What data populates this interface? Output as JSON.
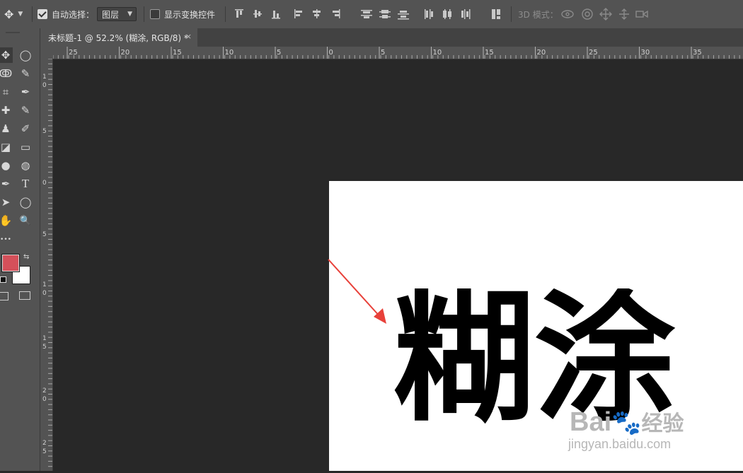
{
  "options_bar": {
    "auto_select_label": "自动选择：",
    "auto_select_checked": true,
    "auto_select_value": "图层",
    "show_transform_label": "显示变换控件",
    "show_transform_checked": false,
    "mode_3d_label": "3D 模式："
  },
  "document_tab": {
    "title": "未标题-1 @ 52.2% (糊涂, RGB/8) *",
    "close_glyph": "×"
  },
  "ruler_h": {
    "labels": [
      "25",
      "20",
      "15",
      "10",
      "5",
      "0",
      "5",
      "10",
      "15",
      "20",
      "25",
      "30",
      "35"
    ]
  },
  "ruler_v": {
    "labels": [
      "1",
      "0",
      "5",
      "0",
      "5",
      "1",
      "0",
      "1",
      "5",
      "2",
      "0",
      "2",
      "5"
    ]
  },
  "colors": {
    "foreground": "#d4505a",
    "background": "#ffffff"
  },
  "canvas": {
    "text": "糊涂",
    "arrow_color": "#e8413a"
  },
  "watermark": {
    "brand": "Bai",
    "brand_tail": "经验",
    "url": "jingyan.baidu.com"
  },
  "icons": {
    "move": "✥",
    "marquee_ellipse": "◯",
    "lasso": "ↂ",
    "quick_select": "✎",
    "crop": "⌗",
    "eyedropper": "✒",
    "healing": "✚",
    "brush": "✎",
    "stamp": "♟",
    "history_brush": "✐",
    "eraser": "◪",
    "gradient": "▭",
    "blur": "●",
    "dodge": "◍",
    "pen": "✒",
    "type": "T",
    "path_select": "➤",
    "shape": "◯",
    "hand": "✋",
    "zoom": "🔍",
    "more": "•••"
  }
}
